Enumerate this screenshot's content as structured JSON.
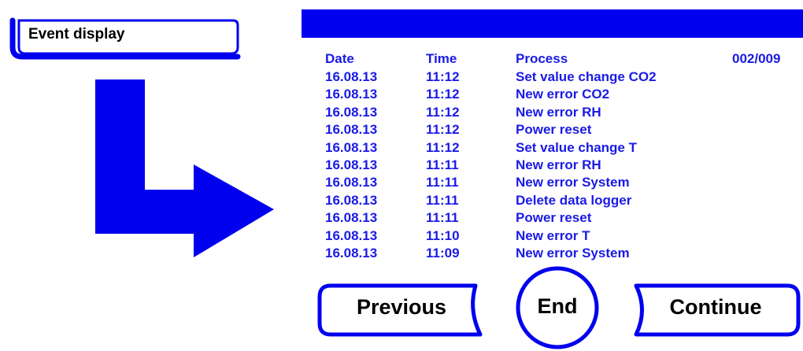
{
  "screen_label": "Event display",
  "colors": {
    "accent": "#0000ee",
    "text_blue": "#1a1ae6",
    "text_black": "#000000"
  },
  "log": {
    "headers": {
      "date": "Date",
      "time": "Time",
      "process": "Process",
      "page": "002/009"
    },
    "rows": [
      {
        "date": "16.08.13",
        "time": "11:12",
        "process": "Set value change CO2"
      },
      {
        "date": "16.08.13",
        "time": "11:12",
        "process": "New error CO2"
      },
      {
        "date": "16.08.13",
        "time": "11:12",
        "process": "New error RH"
      },
      {
        "date": "16.08.13",
        "time": "11:12",
        "process": "Power reset"
      },
      {
        "date": "16.08.13",
        "time": "11:12",
        "process": "Set value change T"
      },
      {
        "date": "16.08.13",
        "time": "11:11",
        "process": "New error RH"
      },
      {
        "date": "16.08.13",
        "time": "11:11",
        "process": "New error System"
      },
      {
        "date": "16.08.13",
        "time": "11:11",
        "process": "Delete data logger"
      },
      {
        "date": "16.08.13",
        "time": "11:11",
        "process": "Power reset"
      },
      {
        "date": "16.08.13",
        "time": "11:10",
        "process": "New error T"
      },
      {
        "date": "16.08.13",
        "time": "11:09",
        "process": "New error System"
      }
    ]
  },
  "buttons": {
    "previous": "Previous",
    "end": "End",
    "continue": "Continue"
  }
}
